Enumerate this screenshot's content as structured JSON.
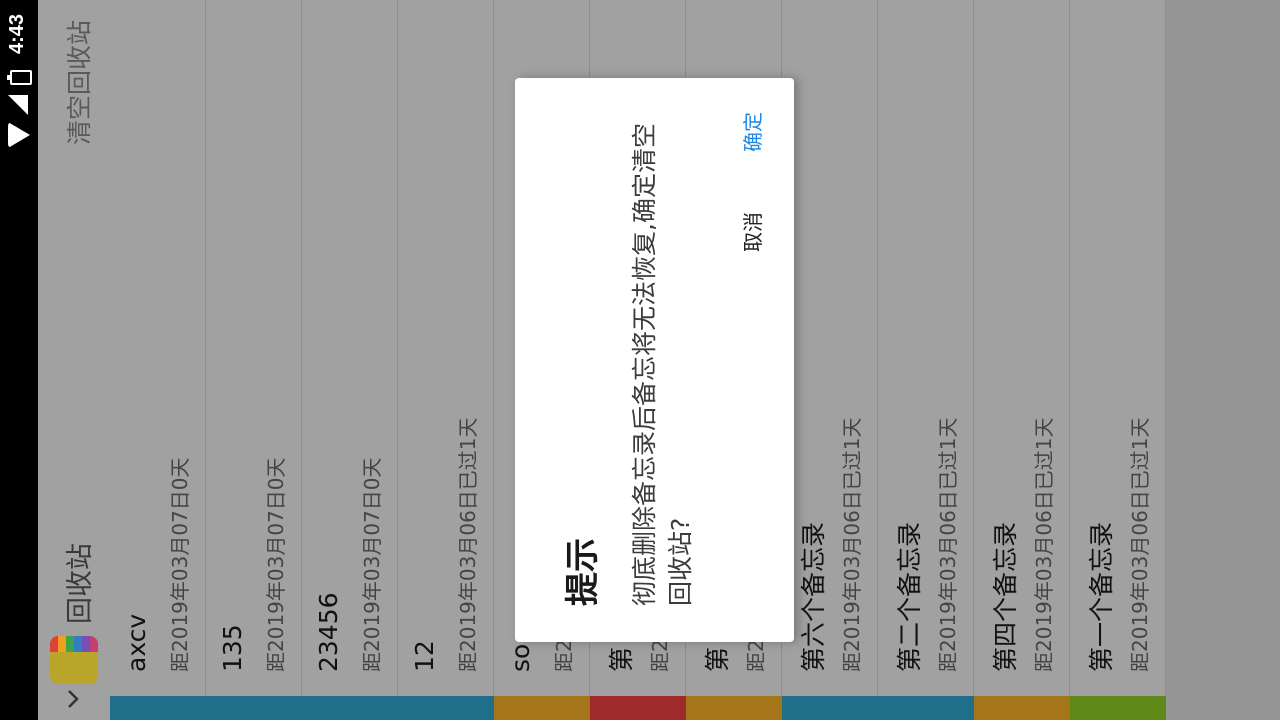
{
  "status_bar": {
    "time": "4:43",
    "icons": [
      "wifi-icon",
      "signal-icon",
      "battery-charging-icon"
    ]
  },
  "toolbar": {
    "back_icon": "chevron-down-icon",
    "logo_icon": "notebook-app-icon",
    "title": "回收站",
    "action_label": "清空回收站"
  },
  "list": {
    "items": [
      {
        "title": "axcv",
        "subtitle": "距2019年03月07日0天",
        "color": "#1f6f8b"
      },
      {
        "title": "135",
        "subtitle": "距2019年03月07日0天",
        "color": "#1f6f8b"
      },
      {
        "title": "23456",
        "subtitle": "距2019年03月07日0天",
        "color": "#1f6f8b"
      },
      {
        "title": "12",
        "subtitle": "距2019年03月06日已过1天",
        "color": "#1f6f8b"
      },
      {
        "title": "so",
        "subtitle": "距2",
        "color": "#a57619"
      },
      {
        "title": "第",
        "subtitle": "距2",
        "color": "#9e2a2b"
      },
      {
        "title": "第",
        "subtitle": "距2",
        "color": "#a57619"
      },
      {
        "title": "第六个备忘录",
        "subtitle": "距2019年03月06日已过1天",
        "color": "#1f6f8b"
      },
      {
        "title": "第二个备忘录",
        "subtitle": "距2019年03月06日已过1天",
        "color": "#1f6f8b"
      },
      {
        "title": "第四个备忘录",
        "subtitle": "距2019年03月06日已过1天",
        "color": "#a57619"
      },
      {
        "title": "第一个备忘录",
        "subtitle": "距2019年03月06日已过1天",
        "color": "#5f8a1a"
      }
    ]
  },
  "dialog": {
    "title": "提示",
    "message": "彻底删除备忘录后备忘将无法恢复,确定清空回收站?",
    "cancel_label": "取消",
    "ok_label": "确定",
    "ok_color": "#1e88e5"
  }
}
